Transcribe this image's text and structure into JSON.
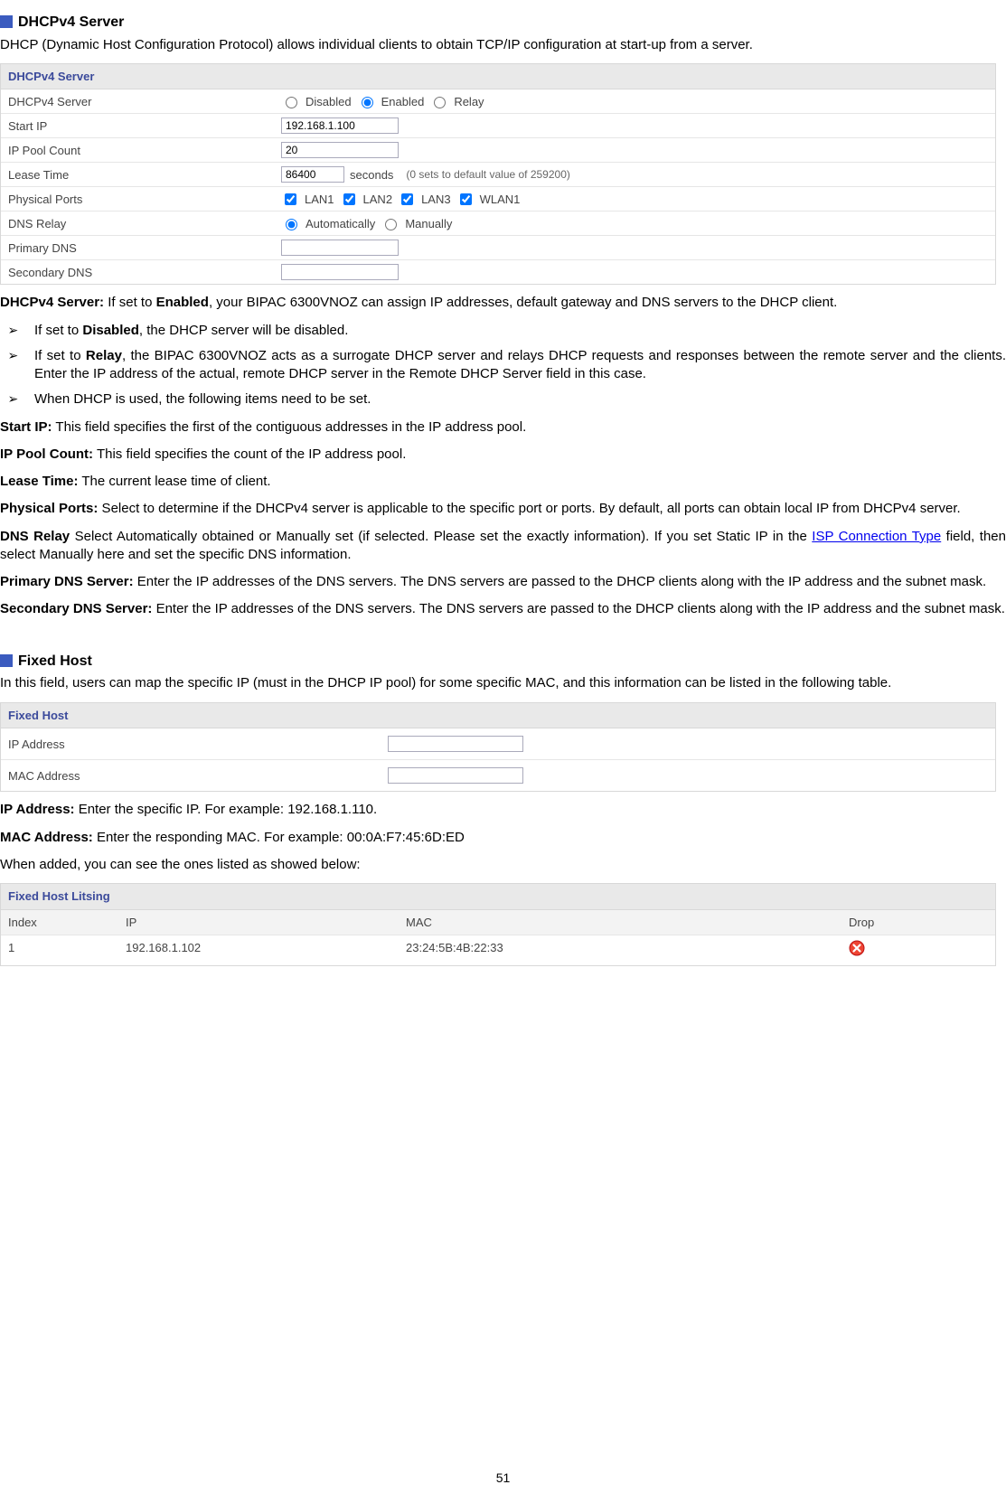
{
  "section1": {
    "title": "DHCPv4 Server",
    "intro": "DHCP (Dynamic Host Configuration Protocol) allows individual clients to obtain TCP/IP configuration at start-up from a server.",
    "table": {
      "header": "DHCPv4 Server",
      "rows": {
        "server_label": "DHCPv4 Server",
        "radio_disabled": "Disabled",
        "radio_enabled": "Enabled",
        "radio_relay": "Relay",
        "startip_label": "Start IP",
        "startip_value": "192.168.1.100",
        "pool_label": "IP Pool Count",
        "pool_value": "20",
        "lease_label": "Lease Time",
        "lease_value": "86400",
        "lease_unit": "seconds",
        "lease_hint": "(0 sets to default value of 259200)",
        "ports_label": "Physical Ports",
        "port1": "LAN1",
        "port2": "LAN2",
        "port3": "LAN3",
        "port4": "WLAN1",
        "dnsrelay_label": "DNS Relay",
        "dnsrelay_auto": "Automatically",
        "dnsrelay_manual": "Manually",
        "pdns_label": "Primary DNS",
        "sdns_label": "Secondary DNS"
      }
    },
    "desc": {
      "dhcpv4_server_prefix": "DHCPv4 Server:",
      "dhcpv4_server_text1": " If set to ",
      "dhcpv4_server_bold1": "Enabled",
      "dhcpv4_server_text2": ", your BIPAC 6300VNOZ can assign IP addresses, default gateway and DNS servers to the DHCP client.",
      "bullet1_pre": "If set to ",
      "bullet1_bold": "Disabled",
      "bullet1_post": ", the DHCP server will be disabled.",
      "bullet2_pre": "If set to ",
      "bullet2_bold": "Relay",
      "bullet2_post": ", the BIPAC 6300VNOZ acts as a surrogate DHCP server and relays DHCP requests and responses between the remote server and the clients. Enter the IP address of the actual, remote DHCP server in the Remote DHCP Server field in this case.",
      "bullet3": "When DHCP is used, the following items need to be set.",
      "startip_label": "Start IP:",
      "startip_text": " This field specifies the first of the contiguous addresses in the IP address pool.",
      "pool_label": "IP Pool Count:",
      "pool_text": " This field specifies the count of the IP address pool.",
      "lease_label": "Lease Time:",
      "lease_text": " The current lease time of client.",
      "ports_label": "Physical Ports:",
      "ports_text": " Select to determine if the DHCPv4 server is applicable to the specific port or ports. By default, all ports can obtain local IP from DHCPv4 server.",
      "dnsrelay_label": "DNS Relay",
      "dnsrelay_text1": " Select Automatically obtained or Manually set (if selected. Please set the exactly information). If you set Static IP in the ",
      "dnsrelay_link": "ISP Connection Type",
      "dnsrelay_text2": " field, then select Manually here and set the specific DNS information.",
      "pdns_label": "Primary DNS Server:",
      "pdns_text": " Enter the IP addresses of the DNS servers. The DNS servers are passed to the DHCP clients along with the IP address and the subnet mask.",
      "sdns_label": "Secondary DNS Server:",
      "sdns_text": " Enter the IP addresses of the DNS servers. The DNS servers are passed to the DHCP clients along with the IP address and the subnet mask."
    }
  },
  "section2": {
    "title": "Fixed Host",
    "intro": "In this field, users can map the specific IP (must in the DHCP IP pool) for some specific MAC, and this information can be listed in the following table.",
    "table": {
      "header": "Fixed Host",
      "ip_label": "IP Address",
      "mac_label": "MAC Address"
    },
    "desc": {
      "ip_label": "IP Address:",
      "ip_text": " Enter the specific IP. For example: 192.168.1.110.",
      "mac_label": "MAC Address:",
      "mac_text": " Enter the responding MAC. For example: 00:0A:F7:45:6D:ED",
      "added_text": "When added, you can see the ones listed as showed below:"
    },
    "listing": {
      "header": "Fixed Host Litsing",
      "col_index": "Index",
      "col_ip": "IP",
      "col_mac": "MAC",
      "col_drop": "Drop",
      "row": {
        "index": "1",
        "ip": "192.168.1.102",
        "mac": "23:24:5B:4B:22:33"
      }
    }
  },
  "page_number": "51"
}
